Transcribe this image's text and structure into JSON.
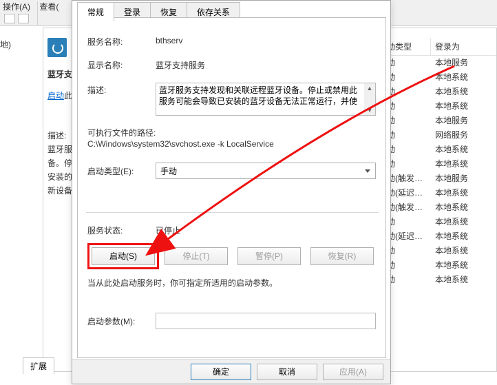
{
  "toolbar": {
    "menu_action": "操作(A)",
    "menu_view": "查看("
  },
  "left_stub": "地)",
  "bg": {
    "head_col1": "动类型",
    "head_col2": "登录为",
    "title": "蓝牙支",
    "link": "启动",
    "link_after": "此",
    "desc_lines": [
      "描述:",
      "蓝牙服",
      "备。停",
      "安装的",
      "新设备"
    ],
    "rows": [
      {
        "c1": "动",
        "c2": "本地服务"
      },
      {
        "c1": "动",
        "c2": "本地系统"
      },
      {
        "c1": "动",
        "c2": "本地系统"
      },
      {
        "c1": "动",
        "c2": "本地系统"
      },
      {
        "c1": "动",
        "c2": "本地服务"
      },
      {
        "c1": "动",
        "c2": "网络服务"
      },
      {
        "c1": "动",
        "c2": "本地系统"
      },
      {
        "c1": "动",
        "c2": "本地系统"
      },
      {
        "c1": "动(触发…",
        "c2": "本地服务"
      },
      {
        "c1": "动(延迟…",
        "c2": "本地系统"
      },
      {
        "c1": "动(触发…",
        "c2": "本地系统"
      },
      {
        "c1": "动",
        "c2": "本地系统"
      },
      {
        "c1": "动(延迟…",
        "c2": "本地系统"
      },
      {
        "c1": "动",
        "c2": "本地系统"
      },
      {
        "c1": "动",
        "c2": "本地系统"
      },
      {
        "c1": "动",
        "c2": "本地系统"
      }
    ]
  },
  "bottom_tab": "扩展",
  "dialog": {
    "tabs": [
      "常规",
      "登录",
      "恢复",
      "依存关系"
    ],
    "service_name_lbl": "服务名称:",
    "service_name_val": "bthserv",
    "display_name_lbl": "显示名称:",
    "display_name_val": "蓝牙支持服务",
    "desc_lbl": "描述:",
    "desc_text": "蓝牙服务支持发现和关联远程蓝牙设备。停止或禁用此服务可能会导致已安装的蓝牙设备无法正常运行，并使",
    "exe_path_lbl": "可执行文件的路径:",
    "exe_path_val": "C:\\Windows\\system32\\svchost.exe -k LocalService",
    "startup_type_lbl": "启动类型(E):",
    "startup_type_val": "手动",
    "status_lbl": "服务状态:",
    "status_val": "已停止",
    "btn_start": "启动(S)",
    "btn_stop": "停止(T)",
    "btn_pause": "暂停(P)",
    "btn_resume": "恢复(R)",
    "hint": "当从此处启动服务时，你可指定所适用的启动参数。",
    "param_lbl": "启动参数(M):",
    "param_val": "",
    "ok": "确定",
    "cancel": "取消",
    "apply": "应用(A)"
  }
}
